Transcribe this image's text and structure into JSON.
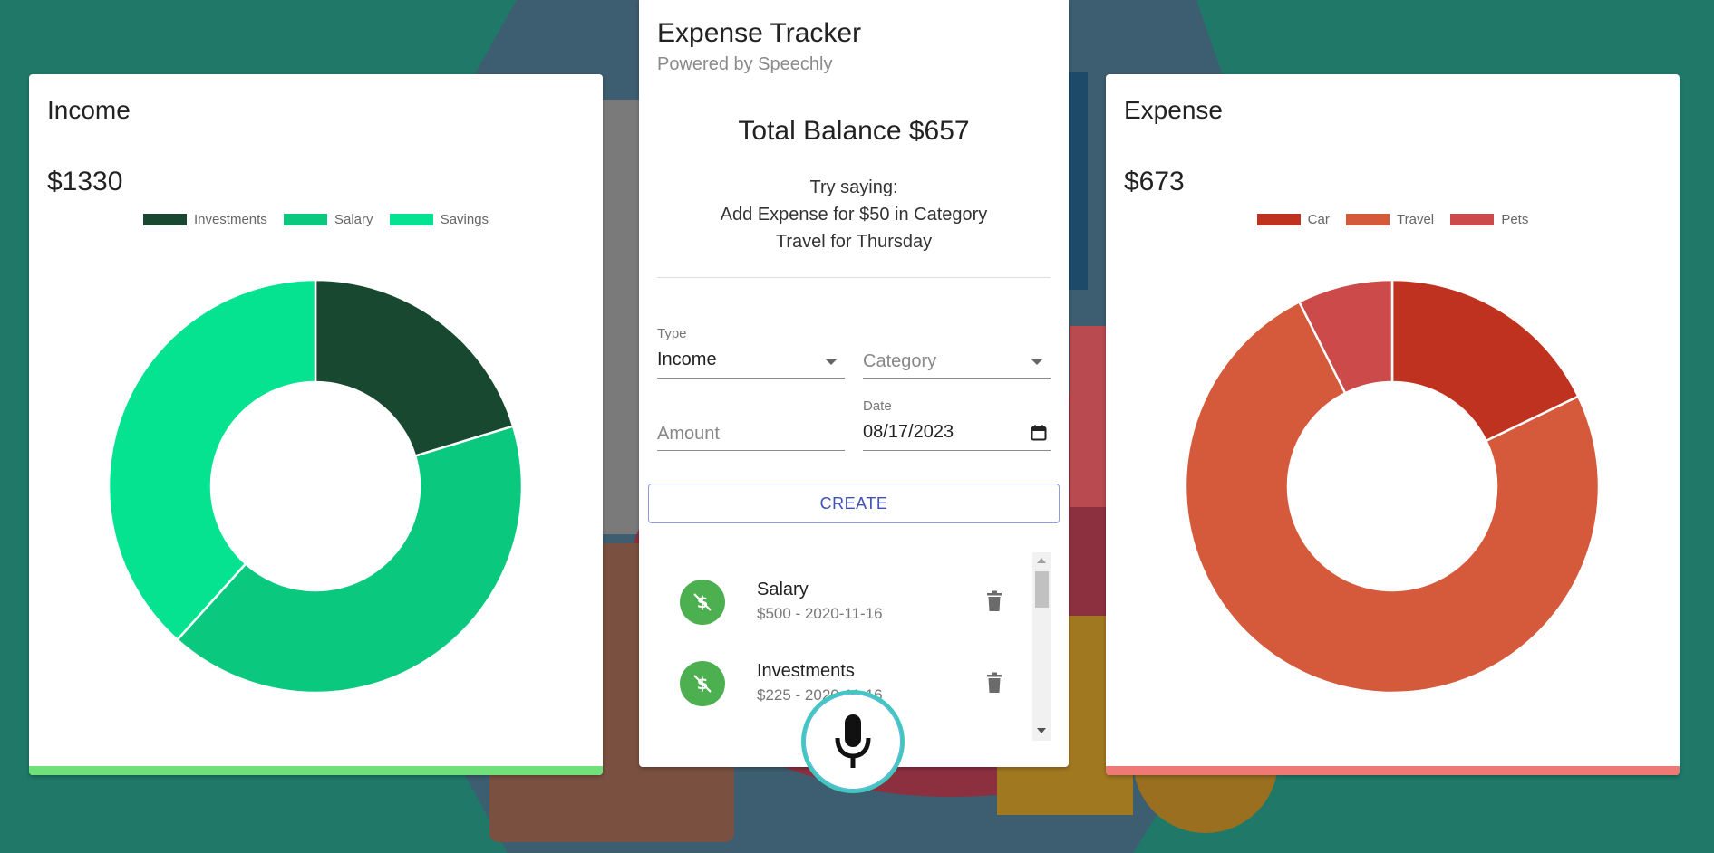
{
  "income": {
    "title": "Income",
    "amount": "$1330",
    "legend": [
      {
        "label": "Investments",
        "color": "#18482f"
      },
      {
        "label": "Salary",
        "color": "#0bc87f"
      },
      {
        "label": "Savings",
        "color": "#05e290"
      }
    ],
    "bar_color": "#6fe07a"
  },
  "expense": {
    "title": "Expense",
    "amount": "$673",
    "legend": [
      {
        "label": "Car",
        "color": "#c03220"
      },
      {
        "label": "Travel",
        "color": "#d5593b"
      },
      {
        "label": "Pets",
        "color": "#cc4a4a"
      }
    ],
    "bar_color": "#ef7a75"
  },
  "chart_data": [
    {
      "type": "pie",
      "categories": [
        "Investments",
        "Salary",
        "Savings"
      ],
      "values": [
        270,
        550,
        510
      ],
      "colors": [
        "#18482f",
        "#0bc87f",
        "#05e290"
      ]
    },
    {
      "type": "pie",
      "categories": [
        "Car",
        "Travel",
        "Pets"
      ],
      "values": [
        120,
        503,
        50
      ],
      "colors": [
        "#c03220",
        "#d5593b",
        "#cc4a4a"
      ]
    }
  ],
  "main": {
    "title": "Expense Tracker",
    "subtitle": "Powered by Speechly",
    "balance": "Total Balance $657",
    "hint_lines": [
      "Try saying:",
      "Add Expense for $50 in Category",
      "Travel for Thursday"
    ],
    "form": {
      "type_label": "Type",
      "type_value": "Income",
      "category_placeholder": "Category",
      "amount_placeholder": "Amount",
      "date_label": "Date",
      "date_value": "08/17/2023",
      "create_label": "CREATE"
    },
    "transactions": [
      {
        "title": "Salary",
        "subtitle": "$500 - 2020-11-16"
      },
      {
        "title": "Investments",
        "subtitle": "$225 - 2020-11-16"
      }
    ]
  },
  "icons": {
    "transaction_avatar": "money-off-icon",
    "delete": "trash-icon",
    "voice": "microphone-icon",
    "date": "calendar-icon"
  }
}
